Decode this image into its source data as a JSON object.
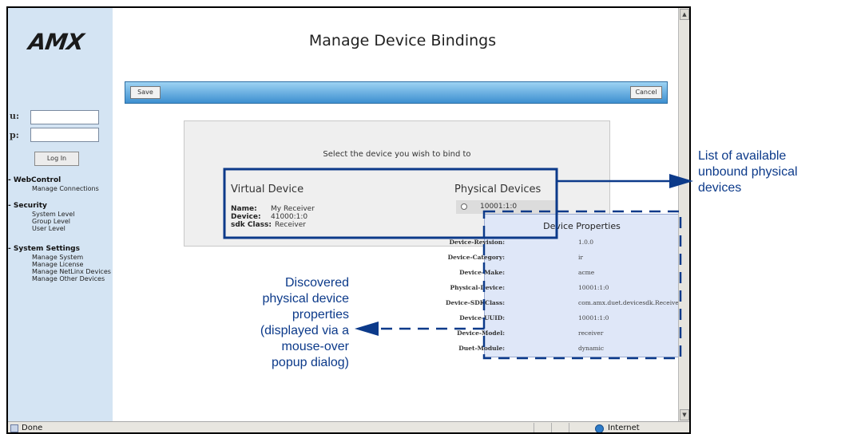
{
  "app": {
    "logo": "AMX",
    "page_title": "Manage Device Bindings"
  },
  "login": {
    "user_label": "u:",
    "pass_label": "p:",
    "button": "Log In"
  },
  "nav": [
    {
      "title": "- WebControl",
      "items": [
        "Manage Connections"
      ]
    },
    {
      "title": "- Security",
      "items": [
        "System Level",
        "Group Level",
        "User Level"
      ]
    },
    {
      "title": "- System Settings",
      "items": [
        "Manage System",
        "Manage License",
        "Manage NetLinx Devices",
        "Manage Other Devices"
      ]
    }
  ],
  "toolbar": {
    "save": "Save",
    "cancel": "Cancel"
  },
  "main": {
    "instruction": "Select the device you wish to bind to",
    "virtual": {
      "heading": "Virtual Device",
      "name_label": "Name:",
      "name": "My Receiver",
      "device_label": "Device:",
      "device": "41000:1:0",
      "sdk_label": "sdk Class:",
      "sdk": "Receiver"
    },
    "physical": {
      "heading": "Physical Devices",
      "option": "10001:1:0"
    }
  },
  "popup": {
    "title": "Device Properties",
    "rows": [
      {
        "key": "Device-Revision:",
        "value": "1.0.0"
      },
      {
        "key": "Device-Category:",
        "value": "ir"
      },
      {
        "key": "Device-Make:",
        "value": "acme"
      },
      {
        "key": "Physical-Device:",
        "value": "10001:1:0"
      },
      {
        "key": "Device-SDKClass:",
        "value": "com.amx.duet.devicesdk.Receiver"
      },
      {
        "key": "Device-UUID:",
        "value": "10001:1:0"
      },
      {
        "key": "Device-Model:",
        "value": "receiver"
      },
      {
        "key": "Duet-Module:",
        "value": "dynamic"
      }
    ]
  },
  "status": {
    "left": "Done",
    "zone": "Internet"
  },
  "annotations": {
    "right": [
      "List of available",
      "unbound physical",
      "devices"
    ],
    "left": [
      "Discovered",
      "physical device",
      "properties",
      "(displayed via a",
      "mouse-over",
      "popup dialog)"
    ]
  },
  "colors": {
    "annotation": "#0c3a8a",
    "toolbar_top": "#9ed3f3",
    "toolbar_bottom": "#3d8fd0",
    "sidebar": "#d4e4f3",
    "popup_bg": "#dfe7f8"
  }
}
